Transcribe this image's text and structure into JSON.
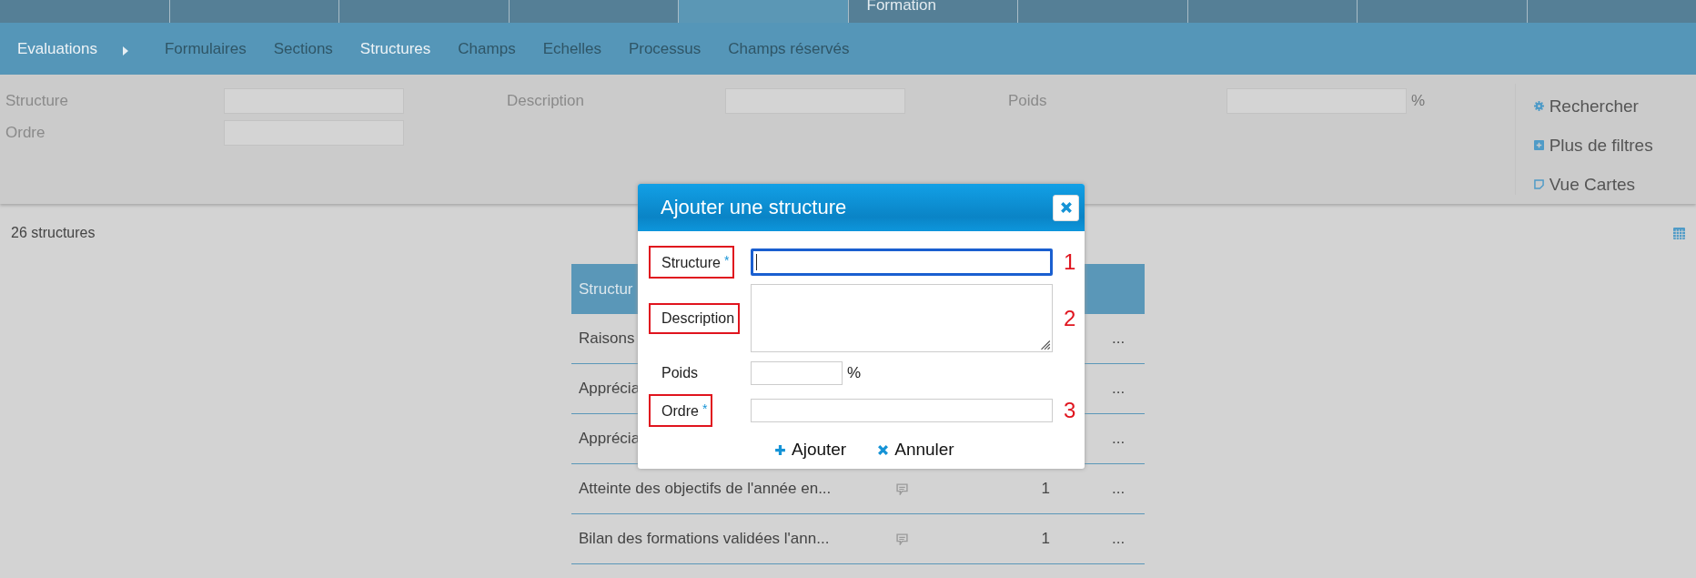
{
  "top_tabs": [
    {
      "selected": false
    },
    {
      "selected": false
    },
    {
      "selected": false
    },
    {
      "selected": false
    },
    {
      "selected": true
    },
    {
      "label": "Formation",
      "selected": false
    },
    {
      "selected": false
    },
    {
      "selected": false
    },
    {
      "selected": false
    },
    {
      "selected": false
    }
  ],
  "nav": {
    "title": "Evaluations",
    "items": [
      {
        "label": "Formulaires",
        "selected": false
      },
      {
        "label": "Sections",
        "selected": false
      },
      {
        "label": "Structures",
        "selected": true
      },
      {
        "label": "Champs",
        "selected": false
      },
      {
        "label": "Echelles",
        "selected": false
      },
      {
        "label": "Processus",
        "selected": false
      },
      {
        "label": "Champs réservés",
        "selected": false
      }
    ]
  },
  "filters": [
    {
      "label": "Structure"
    },
    {
      "label": "Description"
    },
    {
      "label": "Poids",
      "suffix": "%"
    },
    {
      "label": "Ordre"
    }
  ],
  "actions": [
    {
      "kind": "search",
      "label": "Rechercher"
    },
    {
      "kind": "more",
      "label": "Plus de filtres"
    },
    {
      "kind": "cards",
      "label": "Vue Cartes"
    }
  ],
  "count": "26 structures",
  "table": {
    "columns": [
      "Structur"
    ],
    "rows": [
      {
        "column_1": "Raisons",
        "more": "..."
      },
      {
        "column_1": "Apprécia",
        "more": "..."
      },
      {
        "column_1": "Apprécia",
        "more": "..."
      },
      {
        "column_1": "Atteinte des objectifs de l'année en...",
        "comment": true,
        "column_3": "1",
        "more": "..."
      },
      {
        "column_1": "Bilan des formations validées l'ann...",
        "comment": true,
        "column_3": "1",
        "more": "..."
      }
    ]
  },
  "dialog": {
    "title": "Ajouter une structure",
    "fields": [
      {
        "kind": "text",
        "label": "Structure",
        "required_mark": "*",
        "highlighted": true,
        "focused": true,
        "annotation": "1"
      },
      {
        "kind": "textarea",
        "label": "Description",
        "highlighted": true,
        "focused": false,
        "annotation": "2"
      },
      {
        "kind": "short",
        "label": "Poids",
        "highlighted": false,
        "focused": false,
        "suffix": "%"
      },
      {
        "kind": "text",
        "label": "Ordre",
        "required_mark": "*",
        "highlighted": true,
        "focused": false,
        "annotation": "3"
      }
    ],
    "buttons": [
      {
        "kind": "add",
        "label": "Ajouter"
      },
      {
        "kind": "cancel",
        "label": "Annuler"
      }
    ]
  }
}
